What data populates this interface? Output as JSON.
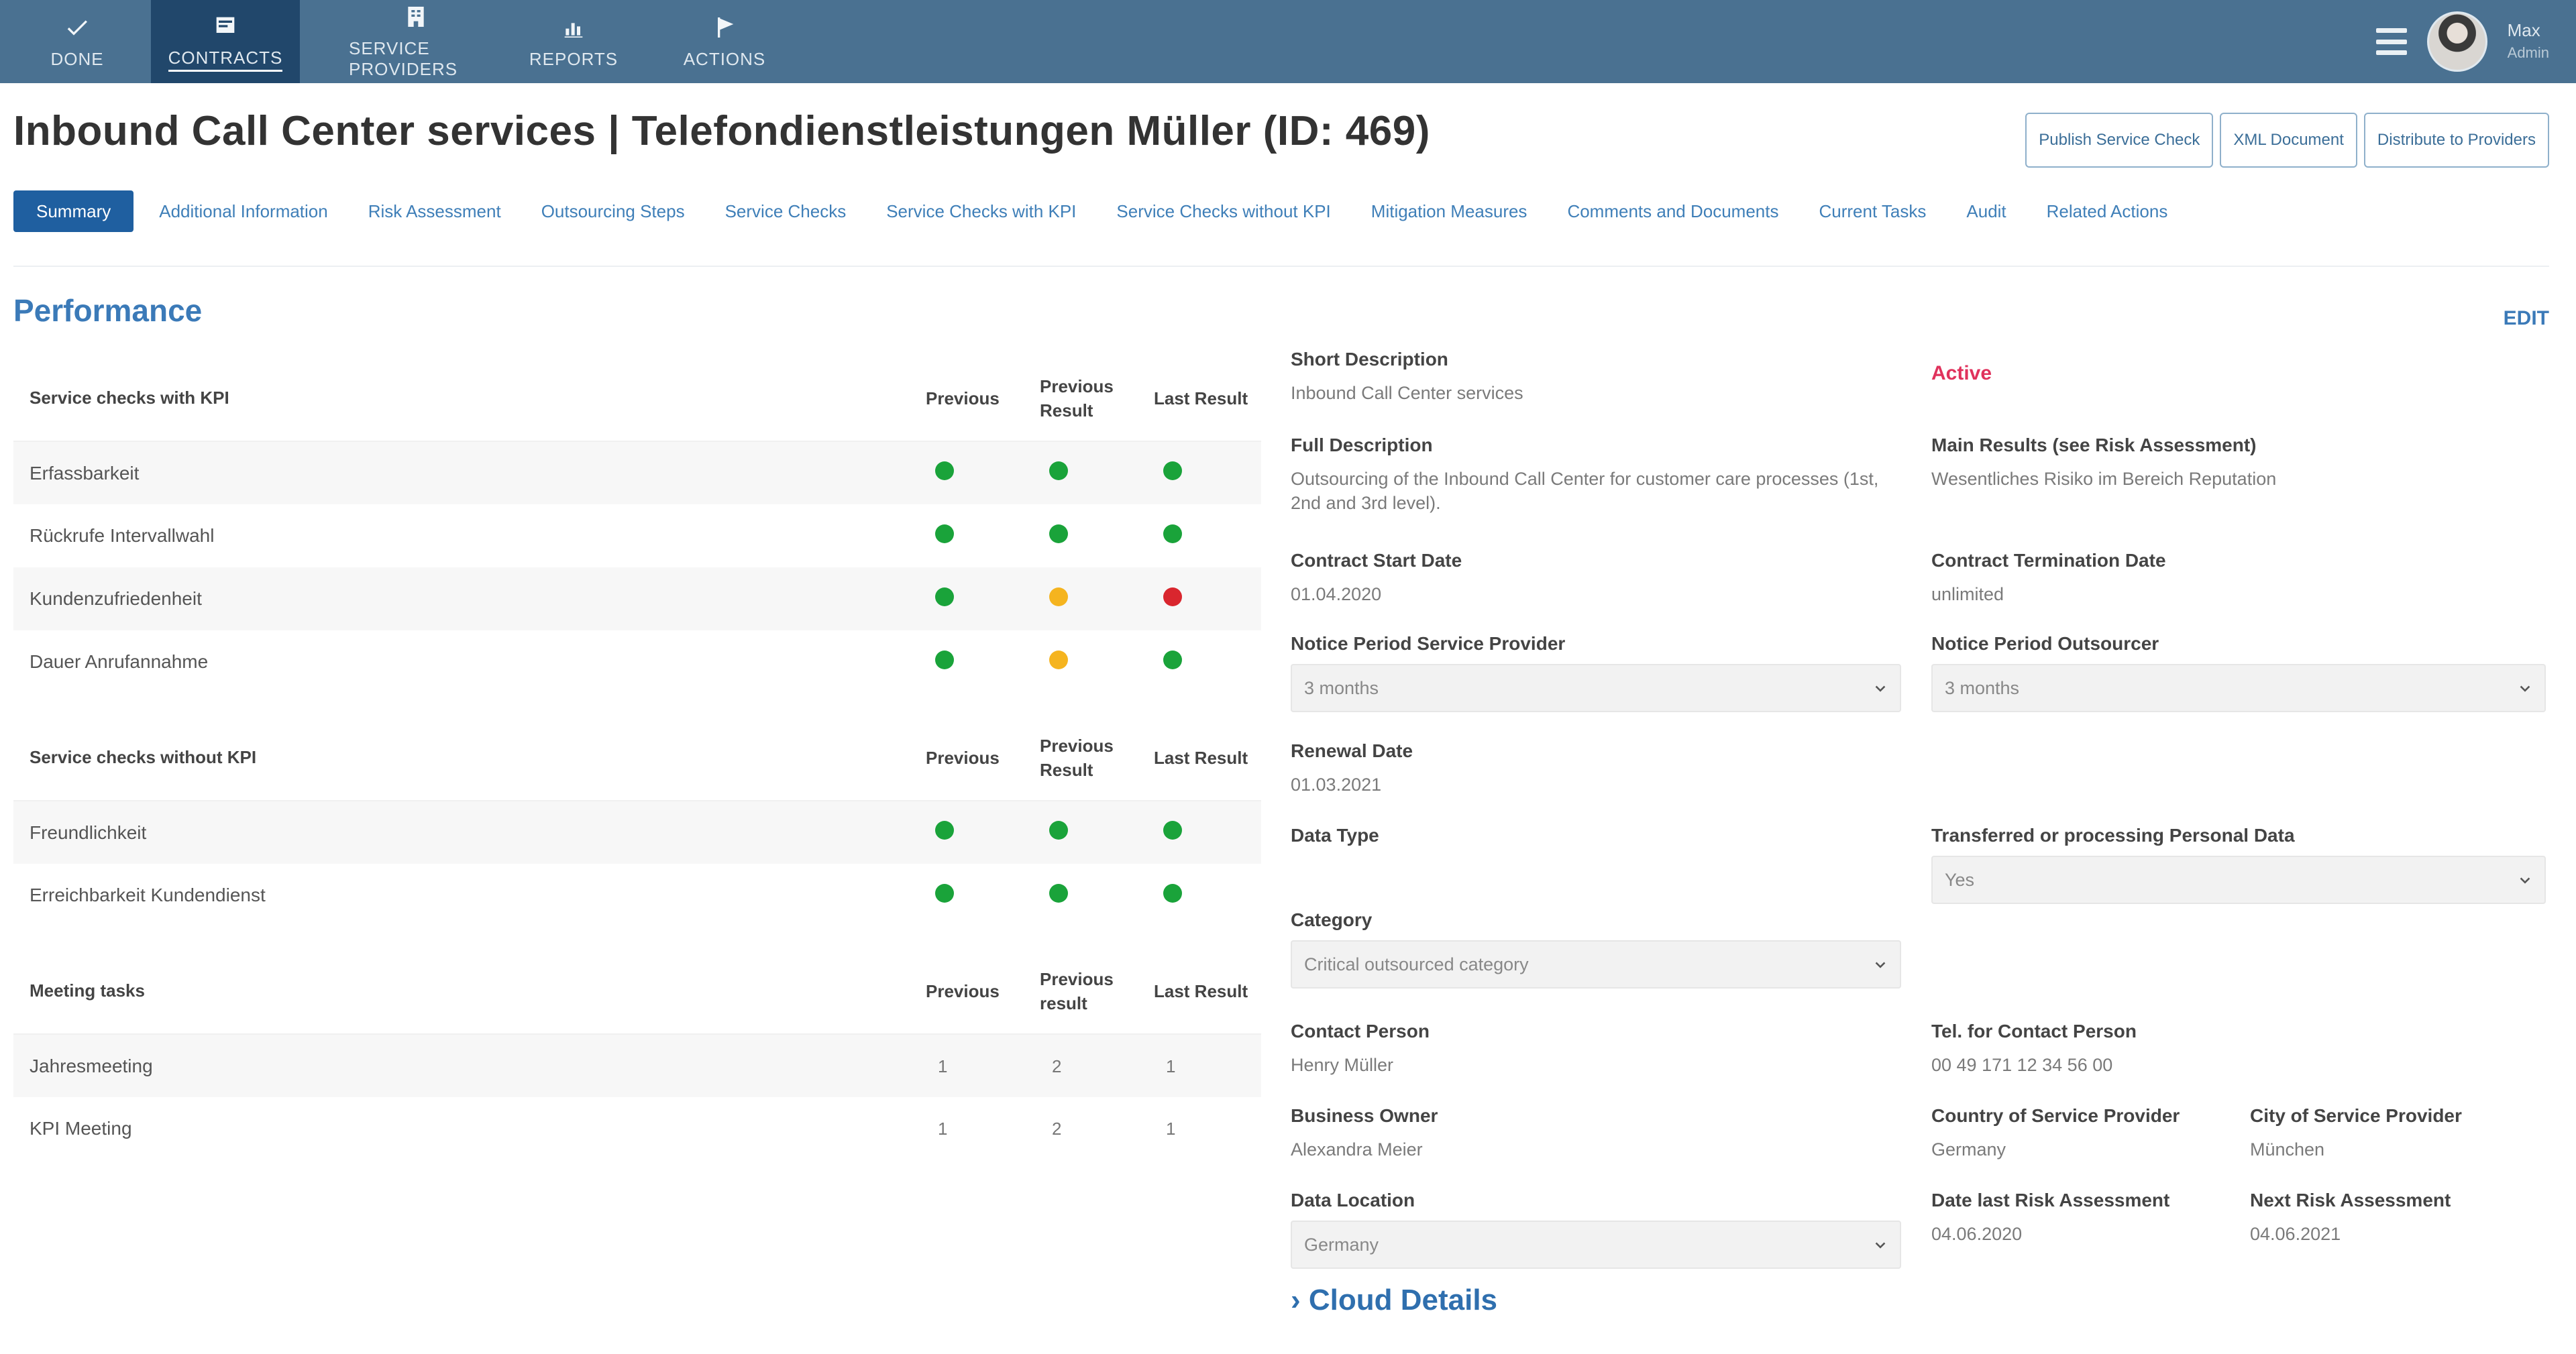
{
  "nav": {
    "items": [
      {
        "label": "Done",
        "icon": "check-icon"
      },
      {
        "label": "Contracts",
        "icon": "contract-icon"
      },
      {
        "label": "Service Providers",
        "icon": "building-icon"
      },
      {
        "label": "Reports",
        "icon": "chart-icon"
      },
      {
        "label": "Actions",
        "icon": "flag-icon"
      }
    ],
    "user": {
      "name": "Max",
      "role": "Admin"
    }
  },
  "page": {
    "title": "Inbound Call Center services | Telefondienstleistungen Müller (ID: 469)"
  },
  "header_buttons": [
    "Publish Service Check",
    "XML Document",
    "Distribute to Providers"
  ],
  "tabs": [
    "Summary",
    "Additional Information",
    "Risk Assessment",
    "Outsourcing Steps",
    "Service Checks",
    "Service Checks with KPI",
    "Service Checks without KPI",
    "Mitigation Measures",
    "Comments and Documents",
    "Current Tasks",
    "Audit",
    "Related Actions"
  ],
  "section": {
    "title": "Performance",
    "edit_label": "EDIT"
  },
  "tables": [
    {
      "header": "Service checks with KPI",
      "col1": "Previous",
      "col2": "Previous Result",
      "col3": "Last Result",
      "rows": [
        {
          "label": "Erfassbarkeit",
          "marks": [
            "green",
            "green",
            "green"
          ]
        },
        {
          "label": "Rückrufe Intervallwahl",
          "marks": [
            "green",
            "green",
            "green"
          ]
        },
        {
          "label": "Kundenzufriedenheit",
          "marks": [
            "green",
            "yellow",
            "red"
          ]
        },
        {
          "label": "Dauer Anrufannahme",
          "marks": [
            "green",
            "yellow",
            "green"
          ]
        }
      ]
    },
    {
      "header": "Service checks without KPI",
      "col1": "Previous",
      "col2": "Previous Result",
      "col3": "Last Result",
      "rows": [
        {
          "label": "Freundlichkeit",
          "marks": [
            "green",
            "green",
            "green"
          ]
        },
        {
          "label": "Erreichbarkeit Kundendienst",
          "marks": [
            "green",
            "green",
            "green"
          ]
        }
      ]
    },
    {
      "header": "Meeting tasks",
      "col1": "Previous",
      "col2": "Previous result",
      "col3": "Last Result",
      "rows": [
        {
          "label": "Jahresmeeting",
          "values": [
            "1",
            "2",
            "1"
          ]
        },
        {
          "label": "KPI Meeting",
          "values": [
            "1",
            "2",
            "1"
          ]
        }
      ]
    }
  ],
  "form": {
    "short_description": {
      "label": "Short Description",
      "value": "Inbound Call Center services"
    },
    "status": "Active",
    "full_description": {
      "label": "Full Description",
      "value": "Outsourcing of the Inbound Call Center for customer care processes (1st, 2nd and 3rd level)."
    },
    "main_results": {
      "label": "Main Results (see Risk Assessment)",
      "value": "Wesentliches Risiko im Bereich Reputation"
    },
    "contract_start": {
      "label": "Contract Start Date",
      "value": "01.04.2020"
    },
    "contract_termination": {
      "label": "Contract Termination Date",
      "value": "unlimited"
    },
    "notice_provider": {
      "label": "Notice Period Service Provider",
      "value": "3 months"
    },
    "notice_outsourcer": {
      "label": "Notice Period Outsourcer",
      "value": "3 months"
    },
    "renewal_date": {
      "label": "Renewal Date",
      "value": "01.03.2021"
    },
    "data_type": {
      "label": "Data Type"
    },
    "transferred": {
      "label": "Transferred or processing Personal Data",
      "value": "Yes"
    },
    "category": {
      "label": "Category",
      "value": "Critical outsourced category"
    },
    "contact_person": {
      "label": "Contact Person",
      "value": "Henry Müller"
    },
    "tel_contact": {
      "label": "Tel. for Contact Person",
      "value": "00 49 171 12 34 56 00"
    },
    "business_owner": {
      "label": "Business Owner",
      "value": "Alexandra Meier"
    },
    "country_provider": {
      "label": "Country of Service Provider",
      "value": "Germany"
    },
    "city_provider": {
      "label": "City of Service Provider",
      "value": "München"
    },
    "data_location": {
      "label": "Data Location",
      "value": "Germany"
    },
    "date_last_risk": {
      "label": "Date last Risk Assessment",
      "value": "04.06.2020"
    },
    "next_risk": {
      "label": "Next Risk Assessment",
      "value": "04.06.2021"
    },
    "cloud_details": "› Cloud Details"
  },
  "colors": {
    "green": "#1aa33a",
    "yellow": "#f5b41f",
    "red": "#d9262e",
    "nav": "#4a7191",
    "accent": "#3b7ab8"
  }
}
